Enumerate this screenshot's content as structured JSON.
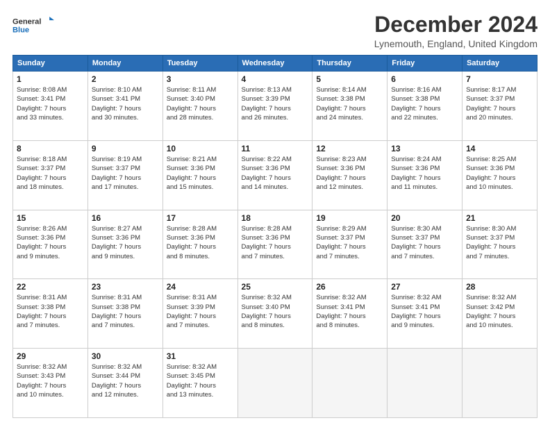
{
  "header": {
    "logo_line1": "General",
    "logo_line2": "Blue",
    "main_title": "December 2024",
    "subtitle": "Lynemouth, England, United Kingdom"
  },
  "calendar": {
    "days_of_week": [
      "Sunday",
      "Monday",
      "Tuesday",
      "Wednesday",
      "Thursday",
      "Friday",
      "Saturday"
    ],
    "weeks": [
      [
        {
          "day": "1",
          "info": "Sunrise: 8:08 AM\nSunset: 3:41 PM\nDaylight: 7 hours\nand 33 minutes."
        },
        {
          "day": "2",
          "info": "Sunrise: 8:10 AM\nSunset: 3:41 PM\nDaylight: 7 hours\nand 30 minutes."
        },
        {
          "day": "3",
          "info": "Sunrise: 8:11 AM\nSunset: 3:40 PM\nDaylight: 7 hours\nand 28 minutes."
        },
        {
          "day": "4",
          "info": "Sunrise: 8:13 AM\nSunset: 3:39 PM\nDaylight: 7 hours\nand 26 minutes."
        },
        {
          "day": "5",
          "info": "Sunrise: 8:14 AM\nSunset: 3:38 PM\nDaylight: 7 hours\nand 24 minutes."
        },
        {
          "day": "6",
          "info": "Sunrise: 8:16 AM\nSunset: 3:38 PM\nDaylight: 7 hours\nand 22 minutes."
        },
        {
          "day": "7",
          "info": "Sunrise: 8:17 AM\nSunset: 3:37 PM\nDaylight: 7 hours\nand 20 minutes."
        }
      ],
      [
        {
          "day": "8",
          "info": "Sunrise: 8:18 AM\nSunset: 3:37 PM\nDaylight: 7 hours\nand 18 minutes."
        },
        {
          "day": "9",
          "info": "Sunrise: 8:19 AM\nSunset: 3:37 PM\nDaylight: 7 hours\nand 17 minutes."
        },
        {
          "day": "10",
          "info": "Sunrise: 8:21 AM\nSunset: 3:36 PM\nDaylight: 7 hours\nand 15 minutes."
        },
        {
          "day": "11",
          "info": "Sunrise: 8:22 AM\nSunset: 3:36 PM\nDaylight: 7 hours\nand 14 minutes."
        },
        {
          "day": "12",
          "info": "Sunrise: 8:23 AM\nSunset: 3:36 PM\nDaylight: 7 hours\nand 12 minutes."
        },
        {
          "day": "13",
          "info": "Sunrise: 8:24 AM\nSunset: 3:36 PM\nDaylight: 7 hours\nand 11 minutes."
        },
        {
          "day": "14",
          "info": "Sunrise: 8:25 AM\nSunset: 3:36 PM\nDaylight: 7 hours\nand 10 minutes."
        }
      ],
      [
        {
          "day": "15",
          "info": "Sunrise: 8:26 AM\nSunset: 3:36 PM\nDaylight: 7 hours\nand 9 minutes."
        },
        {
          "day": "16",
          "info": "Sunrise: 8:27 AM\nSunset: 3:36 PM\nDaylight: 7 hours\nand 9 minutes."
        },
        {
          "day": "17",
          "info": "Sunrise: 8:28 AM\nSunset: 3:36 PM\nDaylight: 7 hours\nand 8 minutes."
        },
        {
          "day": "18",
          "info": "Sunrise: 8:28 AM\nSunset: 3:36 PM\nDaylight: 7 hours\nand 7 minutes."
        },
        {
          "day": "19",
          "info": "Sunrise: 8:29 AM\nSunset: 3:37 PM\nDaylight: 7 hours\nand 7 minutes."
        },
        {
          "day": "20",
          "info": "Sunrise: 8:30 AM\nSunset: 3:37 PM\nDaylight: 7 hours\nand 7 minutes."
        },
        {
          "day": "21",
          "info": "Sunrise: 8:30 AM\nSunset: 3:37 PM\nDaylight: 7 hours\nand 7 minutes."
        }
      ],
      [
        {
          "day": "22",
          "info": "Sunrise: 8:31 AM\nSunset: 3:38 PM\nDaylight: 7 hours\nand 7 minutes."
        },
        {
          "day": "23",
          "info": "Sunrise: 8:31 AM\nSunset: 3:38 PM\nDaylight: 7 hours\nand 7 minutes."
        },
        {
          "day": "24",
          "info": "Sunrise: 8:31 AM\nSunset: 3:39 PM\nDaylight: 7 hours\nand 7 minutes."
        },
        {
          "day": "25",
          "info": "Sunrise: 8:32 AM\nSunset: 3:40 PM\nDaylight: 7 hours\nand 8 minutes."
        },
        {
          "day": "26",
          "info": "Sunrise: 8:32 AM\nSunset: 3:41 PM\nDaylight: 7 hours\nand 8 minutes."
        },
        {
          "day": "27",
          "info": "Sunrise: 8:32 AM\nSunset: 3:41 PM\nDaylight: 7 hours\nand 9 minutes."
        },
        {
          "day": "28",
          "info": "Sunrise: 8:32 AM\nSunset: 3:42 PM\nDaylight: 7 hours\nand 10 minutes."
        }
      ],
      [
        {
          "day": "29",
          "info": "Sunrise: 8:32 AM\nSunset: 3:43 PM\nDaylight: 7 hours\nand 10 minutes."
        },
        {
          "day": "30",
          "info": "Sunrise: 8:32 AM\nSunset: 3:44 PM\nDaylight: 7 hours\nand 12 minutes."
        },
        {
          "day": "31",
          "info": "Sunrise: 8:32 AM\nSunset: 3:45 PM\nDaylight: 7 hours\nand 13 minutes."
        },
        {
          "day": "",
          "info": ""
        },
        {
          "day": "",
          "info": ""
        },
        {
          "day": "",
          "info": ""
        },
        {
          "day": "",
          "info": ""
        }
      ]
    ]
  }
}
